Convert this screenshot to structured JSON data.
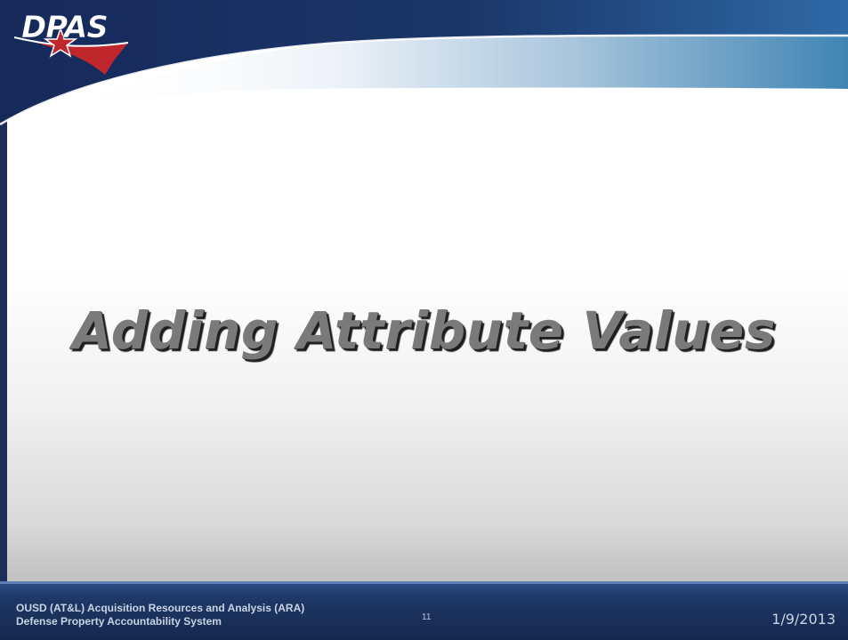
{
  "logo": {
    "text": "DPAS",
    "icon": "star-swoosh"
  },
  "title": "Adding Attribute Values",
  "footer": {
    "org_line1": "OUSD (AT&L) Acquisition Resources and Analysis (ARA)",
    "org_line2": "Defense Property Accountability System",
    "slide_number": "11",
    "date": "1/9/2013"
  },
  "colors": {
    "header_navy": "#1a2e59",
    "header_blue": "#2f6aa6",
    "logo_red": "#c0272d",
    "title_gray": "#7a7a7a",
    "footer_navy": "#14284d"
  }
}
